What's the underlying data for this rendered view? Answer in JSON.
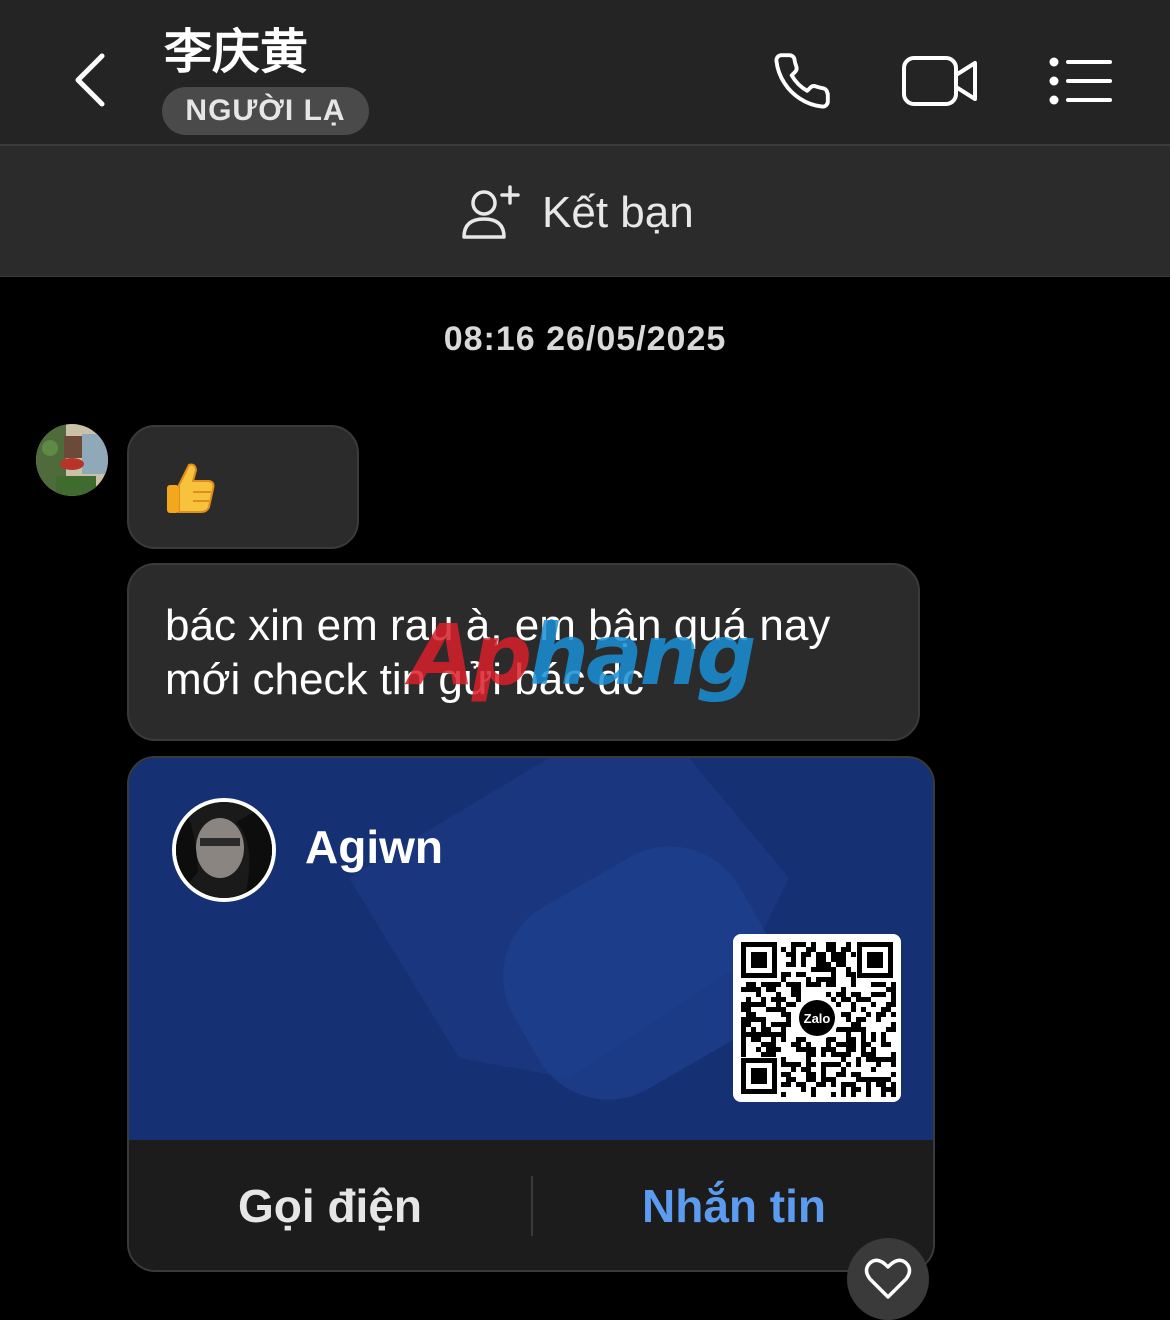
{
  "header": {
    "contact_name": "李庆黄",
    "badge": "NGƯỜI LẠ",
    "icons": [
      "back-icon",
      "phone-icon",
      "video-call-icon",
      "menu-list-icon"
    ]
  },
  "friend_bar": {
    "add_friend_label": "Kết bạn",
    "icon": "add-user-icon"
  },
  "conversation": {
    "timestamp": "08:16 26/05/2025",
    "messages": [
      {
        "type": "emoji",
        "content": "👍"
      },
      {
        "type": "text",
        "content": "bác xin em rau à, em bận quá nay mới check tin gửi bác dc"
      }
    ],
    "contact_card": {
      "name": "Agiwn",
      "qr_label": "Zalo",
      "call_label": "Gọi điện",
      "message_label": "Nhắn tin"
    },
    "reaction_icon": "heart-icon"
  },
  "watermark": {
    "part1": "Ap",
    "part2": "hang"
  },
  "colors": {
    "background": "#000000",
    "header": "#242424",
    "bubble": "#2b2b2b",
    "card_blue": "#163074",
    "accent_blue": "#5b9cf0"
  }
}
